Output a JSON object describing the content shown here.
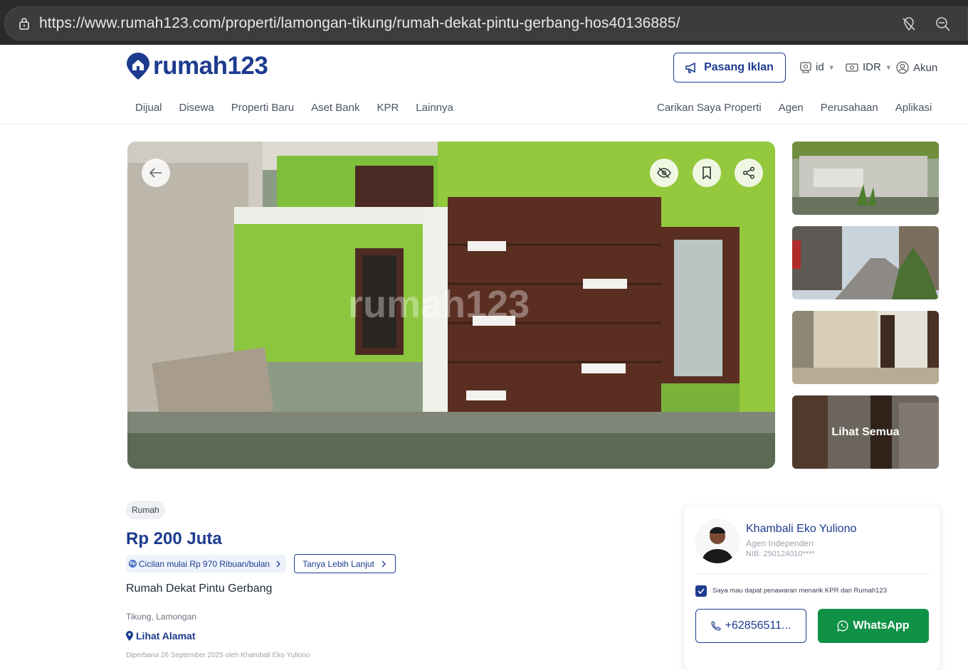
{
  "browser": {
    "url": "https://www.rumah123.com/properti/lamongan-tikung/rumah-dekat-pintu-gerbang-hos40136885/"
  },
  "header": {
    "logo_text": "rumah123",
    "post_ad_label": "Pasang Iklan",
    "language": "id",
    "currency": "IDR",
    "account": "Akun"
  },
  "nav": {
    "left": [
      "Dijual",
      "Disewa",
      "Properti Baru",
      "Aset Bank",
      "KPR",
      "Lainnya"
    ],
    "right": [
      "Carikan Saya Properti",
      "Agen",
      "Perusahaan",
      "Aplikasi"
    ]
  },
  "gallery": {
    "watermark": "rumah123",
    "see_all_label": "Lihat Semua"
  },
  "listing": {
    "type_tag": "Rumah",
    "price": "Rp 200 Juta",
    "installment": "Cicilan mulai Rp 970 Ribuan/bulan",
    "ask_more": "Tanya Lebih Lanjut",
    "title": "Rumah Dekat Pintu Gerbang",
    "location": "Tikung, Lamongan",
    "see_address": "Lihat Alamat",
    "updated": "Diperbarui 26 September 2025 oleh Khambali Eko Yuliono"
  },
  "agent": {
    "name": "Khambali Eko Yuliono",
    "type": "Agen Independen",
    "nib": "NIB: 250124010****",
    "kpr_consent": "Saya mau dapat penawaran menarik KPR dari Rumah123",
    "kpr_checked": true,
    "phone": "+62856511...",
    "whatsapp": "WhatsApp"
  },
  "colors": {
    "brand": "#1d3b8f",
    "whatsapp": "#0f9146"
  }
}
